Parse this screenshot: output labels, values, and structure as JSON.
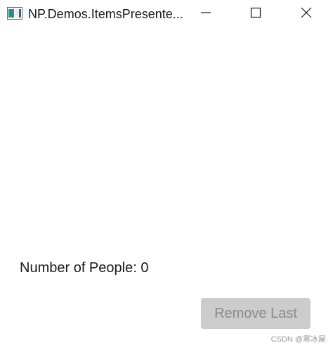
{
  "window": {
    "title": "NP.Demos.ItemsPresente...",
    "icon": "app-window-icon",
    "controls": {
      "minimize_icon": "minimize-icon",
      "maximize_icon": "maximize-icon",
      "close_icon": "close-icon"
    }
  },
  "main": {
    "people_count_label": "Number of People: 0",
    "remove_last_label": "Remove Last",
    "remove_last_enabled": false
  },
  "watermark": {
    "text": "CSDN @寒冰屋"
  },
  "colors": {
    "button_disabled_bg": "#cccccc",
    "button_disabled_text": "#8a8a8a",
    "text": "#1a1a1a"
  }
}
